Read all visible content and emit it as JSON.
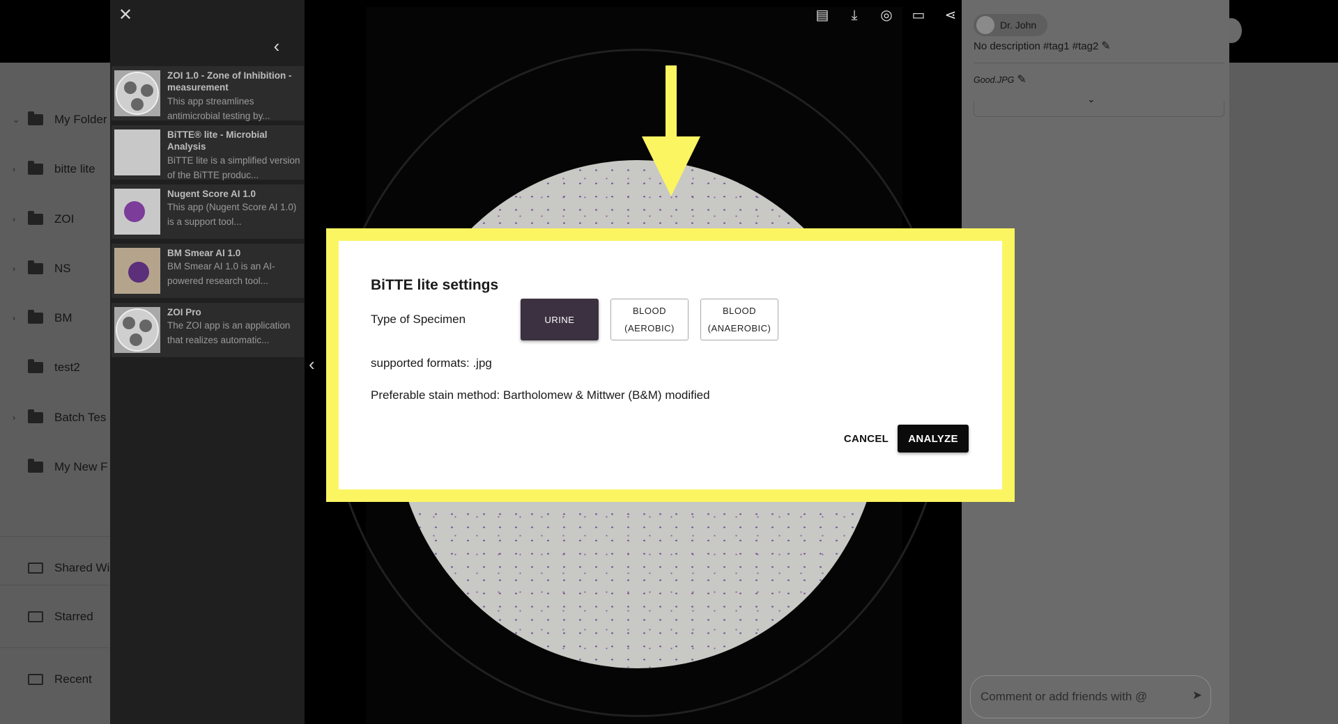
{
  "sidebar": {
    "items": [
      {
        "label": "My Folder",
        "chevron": true,
        "icon": "person-folder-icon"
      },
      {
        "label": "bitte lite",
        "chevron": true,
        "icon": "folder-icon"
      },
      {
        "label": "ZOI",
        "chevron": true,
        "icon": "folder-icon"
      },
      {
        "label": "NS",
        "chevron": true,
        "icon": "folder-icon"
      },
      {
        "label": "BM",
        "chevron": true,
        "icon": "folder-icon"
      },
      {
        "label": "test2",
        "chevron": false,
        "icon": "folder-icon"
      },
      {
        "label": "Batch Tes",
        "chevron": true,
        "icon": "folder-icon"
      },
      {
        "label": "My New F",
        "chevron": false,
        "icon": "folder-icon"
      }
    ],
    "sections": [
      {
        "label": "Shared Wi",
        "icon": "shared-folder-icon"
      },
      {
        "label": "Starred",
        "icon": "starred-folder-icon"
      },
      {
        "label": "Recent",
        "icon": "recent-folder-icon"
      }
    ]
  },
  "apps": [
    {
      "title": "ZOI 1.0 - Zone of Inhibition - measurement",
      "desc": "This app streamlines antimicrobial testing by..."
    },
    {
      "title": "BiTTE® lite - Microbial Analysis",
      "desc": "BiTTE lite is a simplified version of the BiTTE produc..."
    },
    {
      "title": "Nugent Score AI 1.0",
      "desc": "This app (Nugent Score AI 1.0) is a support tool..."
    },
    {
      "title": "BM Smear AI 1.0",
      "desc": "BM Smear AI 1.0 is an AI-powered research tool..."
    },
    {
      "title": "ZOI Pro",
      "desc": "The ZOI app is an application that realizes automatic..."
    }
  ],
  "toolbar": {
    "icons": [
      "pdf-icon",
      "download-icon",
      "visibility-off-icon",
      "comment-icon",
      "share-icon"
    ]
  },
  "details": {
    "user": "Dr. John",
    "description": "No description #tag1 #tag2",
    "filename": "Good.JPG",
    "comment_placeholder": "Comment or add friends with @"
  },
  "dialog": {
    "title": "BiTTE lite settings",
    "specimen_label": "Type of Specimen",
    "specimen_options": [
      {
        "line1": "URINE",
        "line2": "",
        "selected": true
      },
      {
        "line1": "BLOOD",
        "line2": "(AEROBIC)",
        "selected": false
      },
      {
        "line1": "BLOOD",
        "line2": "(ANAEROBIC)",
        "selected": false
      }
    ],
    "formats": "supported formats: .jpg",
    "stain": "Preferable stain method: Bartholomew & Mittwer (B&M) modified",
    "cancel_label": "CANCEL",
    "analyze_label": "ANALYZE"
  },
  "colors": {
    "highlight": "#fcf562",
    "selected_option": "#3c3140",
    "analyze_button": "#0b0b0b",
    "stain_dots": "#6b3d8f"
  }
}
